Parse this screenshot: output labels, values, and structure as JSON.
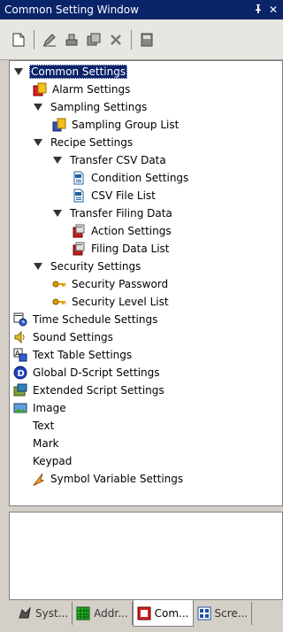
{
  "window": {
    "title": "Common Setting Window",
    "pin_glyph": "↕",
    "close_glyph": "✕"
  },
  "toolbar": {
    "buttons": [
      {
        "name": "new-icon"
      },
      {
        "name": "pencil-icon"
      },
      {
        "name": "stamp-icon"
      },
      {
        "name": "duplicate-icon"
      },
      {
        "name": "delete-icon"
      },
      {
        "name": "properties-icon"
      }
    ]
  },
  "tree": {
    "common_settings": "Common Settings",
    "alarm_settings": "Alarm Settings",
    "sampling_settings": "Sampling Settings",
    "sampling_group_list": "Sampling Group List",
    "recipe_settings": "Recipe Settings",
    "transfer_csv_data": "Transfer CSV Data",
    "condition_settings": "Condition Settings",
    "csv_file_list": "CSV File List",
    "transfer_filing_data": "Transfer Filing Data",
    "action_settings": "Action Settings",
    "filing_data_list": "Filing Data List",
    "security_settings": "Security Settings",
    "security_password": "Security Password",
    "security_level_list": "Security Level List",
    "time_schedule_settings": "Time Schedule Settings",
    "sound_settings": "Sound Settings",
    "text_table_settings": "Text Table Settings",
    "global_dscript_settings": "Global D-Script Settings",
    "extended_script_settings": "Extended Script Settings",
    "image": "Image",
    "text": "Text",
    "mark": "Mark",
    "keypad": "Keypad",
    "symbol_variable_settings": "Symbol Variable Settings"
  },
  "tabs": [
    {
      "label": "Syst..."
    },
    {
      "label": "Addr..."
    },
    {
      "label": "Com..."
    },
    {
      "label": "Scre..."
    }
  ],
  "colors": {
    "selection": "#0a246a",
    "titlebar": "#0a246a",
    "panel": "#d4d0c8"
  }
}
